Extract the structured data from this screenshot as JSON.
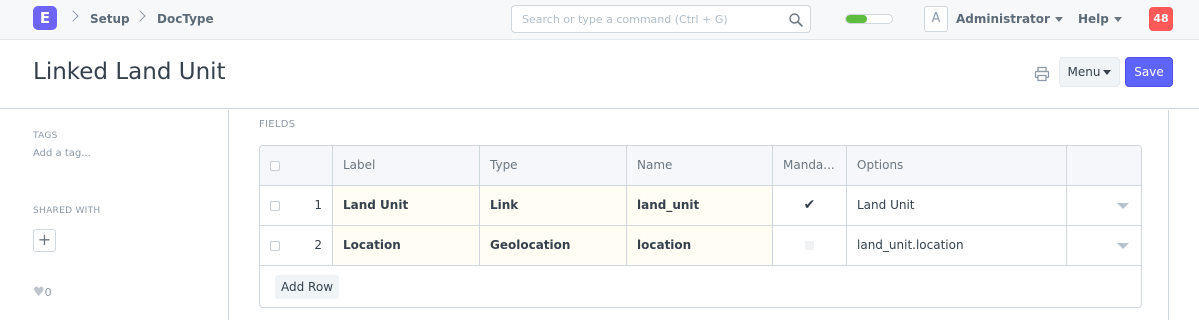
{
  "navbar": {
    "logo": "E",
    "breadcrumbs": [
      "Setup",
      "DocType"
    ],
    "search_placeholder": "Search or type a command (Ctrl + G)",
    "progress_fraction": 0.45,
    "avatar_initial": "A",
    "user": "Administrator",
    "help": "Help",
    "notification_count": "48"
  },
  "page": {
    "title": "Linked Land Unit",
    "menu_label": "Menu",
    "save_label": "Save"
  },
  "sidebar": {
    "tags_label": "TAGS",
    "add_tag": "Add a tag...",
    "shared_label": "SHARED WITH",
    "add_share": "+",
    "likes": "0"
  },
  "fields": {
    "section_label": "FIELDS",
    "columns": [
      "Label",
      "Type",
      "Name",
      "Manda...",
      "Options"
    ],
    "rows": [
      {
        "idx": "1",
        "label": "Land Unit",
        "type": "Link",
        "name": "land_unit",
        "mandatory": true,
        "options": "Land Unit"
      },
      {
        "idx": "2",
        "label": "Location",
        "type": "Geolocation",
        "name": "location",
        "mandatory": false,
        "options": "land_unit.location"
      }
    ],
    "add_row": "Add Row"
  },
  "colors": {
    "brand": "#6e64f5",
    "primary": "#5e64ff",
    "notification": "#ff5858",
    "progress": "#5ebd3c"
  },
  "icons": [
    "chevron-right-icon",
    "search-icon",
    "caret-down-icon",
    "printer-icon",
    "check-icon",
    "heart-icon",
    "plus-icon"
  ]
}
